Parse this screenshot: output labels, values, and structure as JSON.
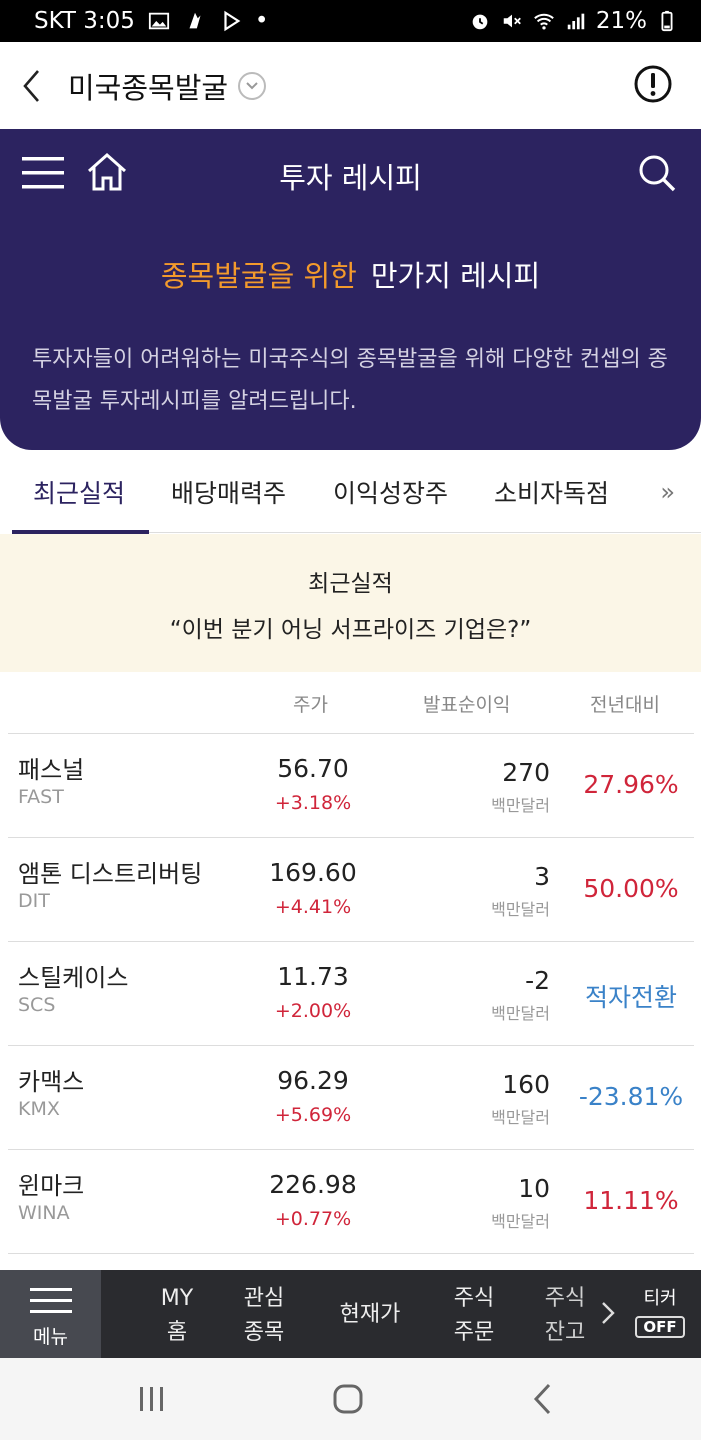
{
  "status_bar": {
    "carrier_time": "SKT 3:05",
    "dot": "•",
    "battery": "21%"
  },
  "app_header": {
    "title": "미국종목발굴"
  },
  "nav": {
    "title": "투자 레시피"
  },
  "hero": {
    "title_orange": "종목발굴을 위한",
    "title_white": "만가지 레시피",
    "description": "투자자들이 어려워하는 미국주식의 종목발굴을 위해 다양한 컨셉의 종목발굴 투자레시피를 알려드립니다."
  },
  "tabs": [
    {
      "label": "최근실적",
      "active": true
    },
    {
      "label": "배당매력주"
    },
    {
      "label": "이익성장주"
    },
    {
      "label": "소비자독점"
    }
  ],
  "tabs_more": "»",
  "banner": {
    "title": "최근실적",
    "quote": "“이번 분기 어닝 서프라이즈 기업은?”"
  },
  "table": {
    "headers": {
      "price": "주가",
      "earnings": "발표순이익",
      "yoy": "전년대비"
    },
    "rows": [
      {
        "name": "패스널",
        "ticker": "FAST",
        "price": "56.70",
        "change": "+3.18%",
        "earnings": "270",
        "unit": "백만달러",
        "yoy": "27.96%",
        "yoy_color": "#d0253a"
      },
      {
        "name": "앰톤 디스트리버팅",
        "ticker": "DIT",
        "price": "169.60",
        "change": "+4.41%",
        "earnings": "3",
        "unit": "백만달러",
        "yoy": "50.00%",
        "yoy_color": "#d0253a"
      },
      {
        "name": "스틸케이스",
        "ticker": "SCS",
        "price": "11.73",
        "change": "+2.00%",
        "earnings": "-2",
        "unit": "백만달러",
        "yoy": "적자전환",
        "yoy_color": "#3a82c8"
      },
      {
        "name": "카맥스",
        "ticker": "KMX",
        "price": "96.29",
        "change": "+5.69%",
        "earnings": "160",
        "unit": "백만달러",
        "yoy": "-23.81%",
        "yoy_color": "#3a82c8"
      },
      {
        "name": "윈마크",
        "ticker": "WINA",
        "price": "226.98",
        "change": "+0.77%",
        "earnings": "10",
        "unit": "백만달러",
        "yoy": "11.11%",
        "yoy_color": "#d0253a"
      }
    ]
  },
  "bottom_menu": {
    "menu_label": "메뉴",
    "items": [
      {
        "line1": "MY",
        "line2": "홈"
      },
      {
        "line1": "관심",
        "line2": "종목"
      },
      {
        "line1": "현재가"
      },
      {
        "line1": "주식",
        "line2": "주문"
      },
      {
        "line1": "주식",
        "line2": "잔고"
      }
    ],
    "ticker_label": "티커",
    "ticker_state": "OFF"
  },
  "colors": {
    "primary": "#2c2360",
    "accent": "#f39a2c",
    "up": "#d0253a",
    "down": "#3a82c8"
  }
}
